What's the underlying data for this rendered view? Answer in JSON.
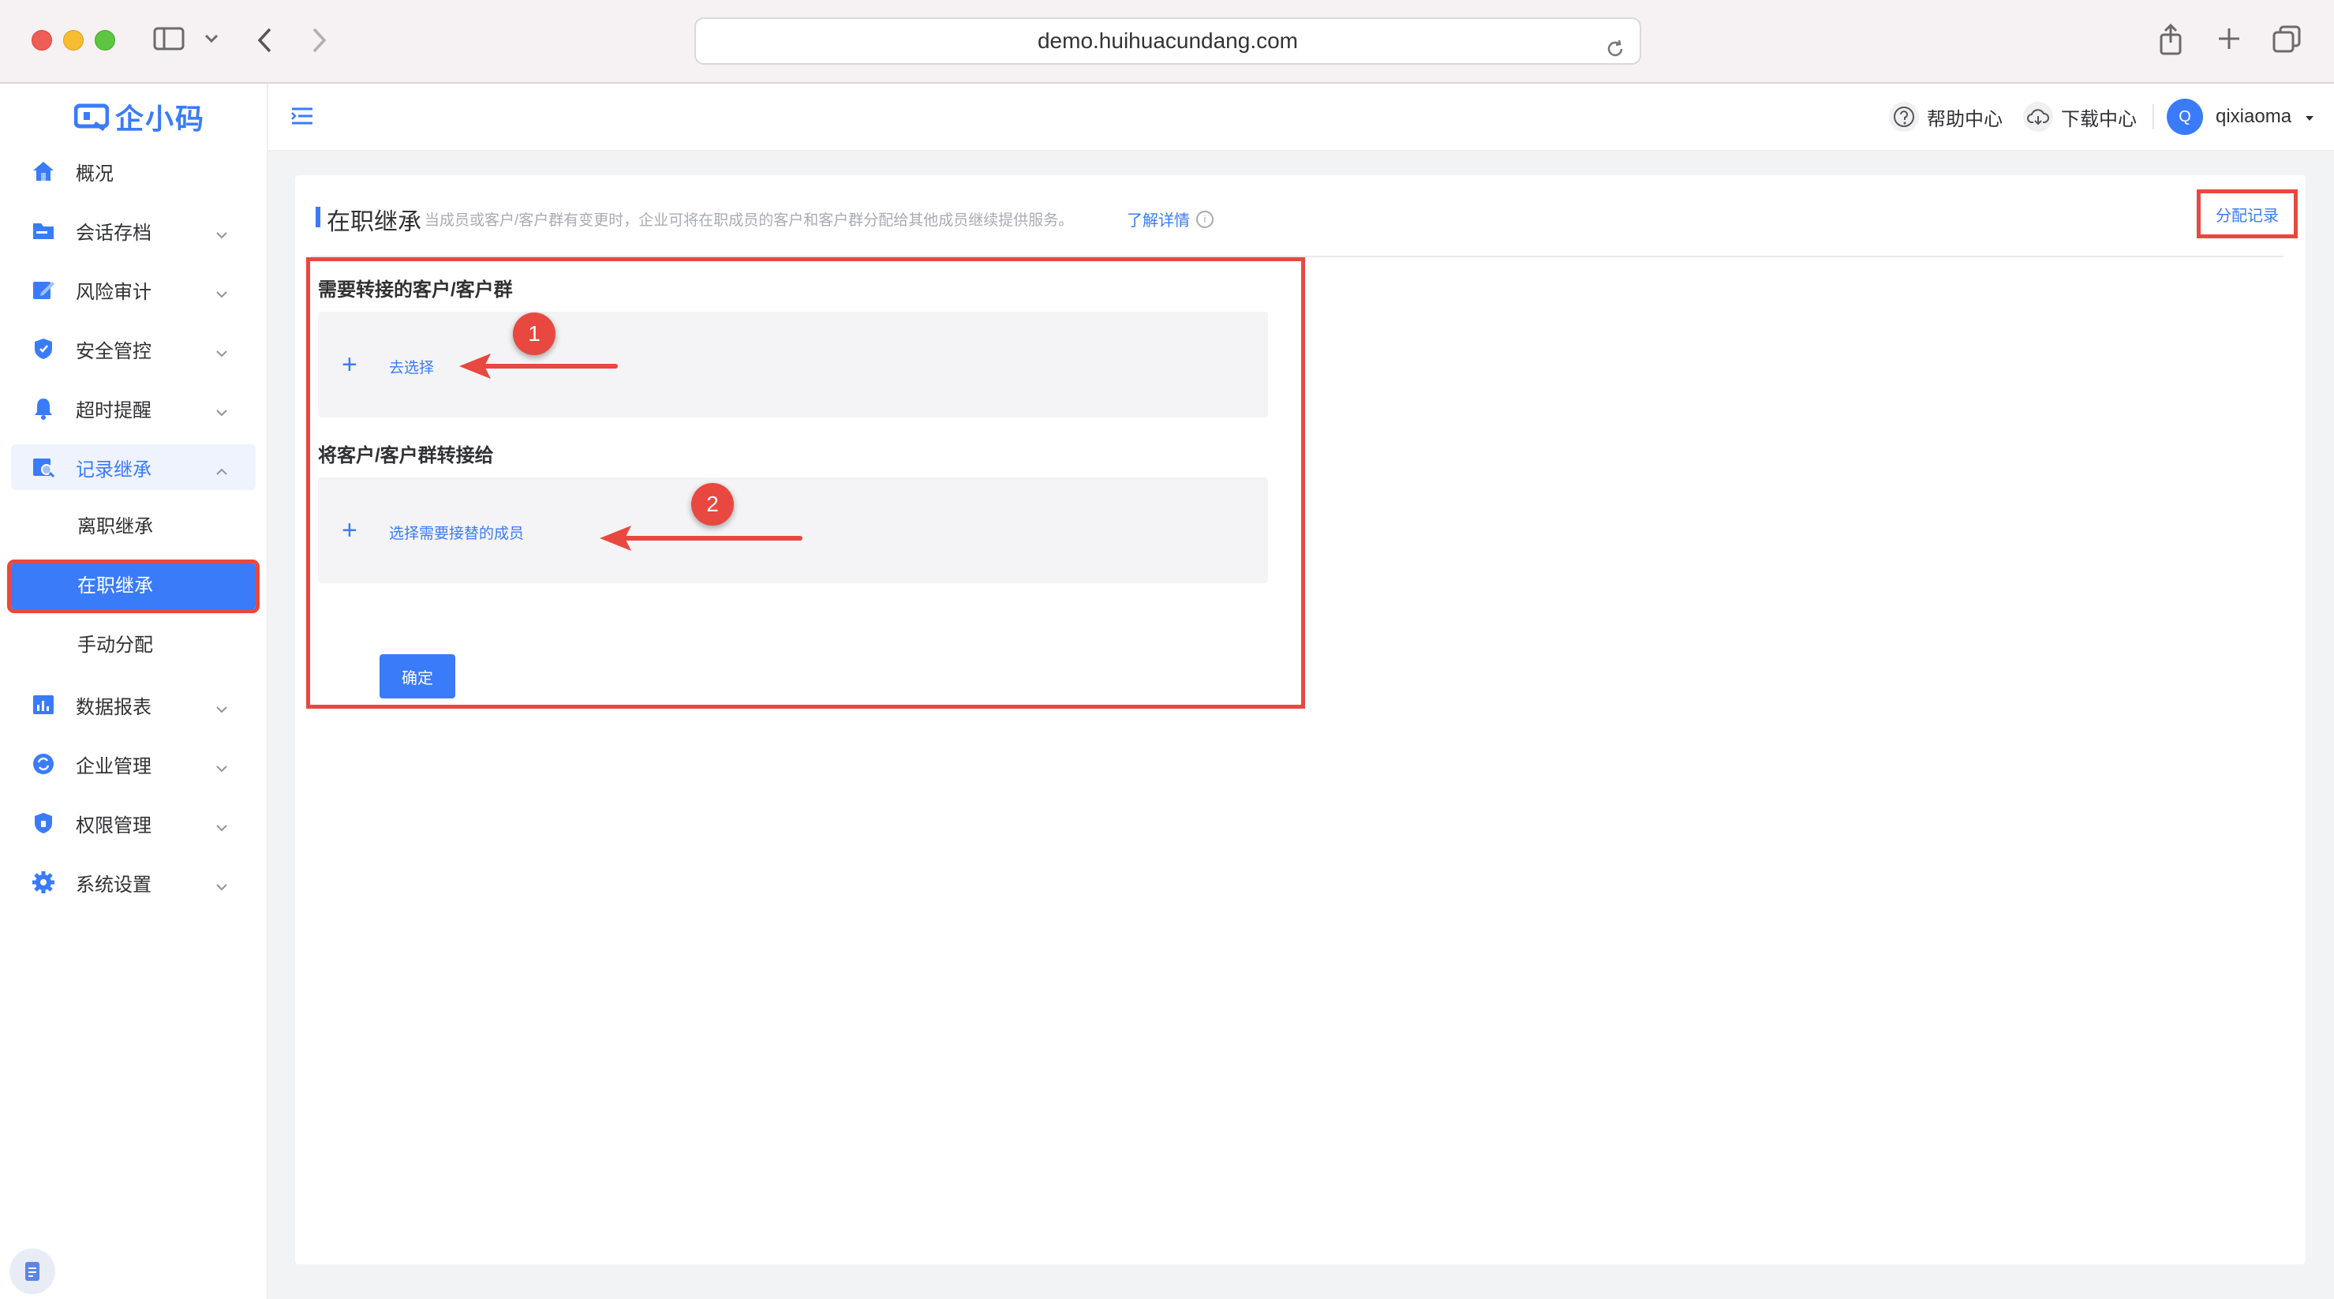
{
  "browser": {
    "url": "demo.huihuacundang.com"
  },
  "sidebar": {
    "logo_text": "企小码",
    "items": [
      {
        "label": "概况",
        "icon": "home-icon"
      },
      {
        "label": "会话存档",
        "icon": "folder-icon"
      },
      {
        "label": "风险审计",
        "icon": "edit-icon"
      },
      {
        "label": "安全管控",
        "icon": "shield-icon"
      },
      {
        "label": "超时提醒",
        "icon": "bell-icon"
      },
      {
        "label": "记录继承",
        "icon": "record-icon"
      },
      {
        "label": "数据报表",
        "icon": "chart-icon"
      },
      {
        "label": "企业管理",
        "icon": "sync-icon"
      },
      {
        "label": "权限管理",
        "icon": "lock-shield-icon"
      },
      {
        "label": "系统设置",
        "icon": "gear-icon"
      }
    ],
    "sub_items": [
      "离职继承",
      "在职继承",
      "手动分配"
    ],
    "active_sub": "在职继承"
  },
  "header": {
    "help_label": "帮助中心",
    "download_label": "下载中心",
    "avatar_letter": "Q",
    "username": "qixiaoma"
  },
  "page": {
    "title": "在职继承",
    "description": "当成员或客户/客户群有变更时，企业可将在职成员的客户和客户群分配给其他成员继续提供服务。",
    "detail_link": "了解详情",
    "record_link": "分配记录",
    "section1_label": "需要转接的客户/客户群",
    "section1_action": "去选择",
    "section2_label": "将客户/客户群转接给",
    "section2_action": "选择需要接替的成员",
    "confirm_label": "确定"
  },
  "annotations": {
    "badge1": "1",
    "badge2": "2",
    "color": "#e8483f"
  },
  "colors": {
    "accent": "#3a7bfa",
    "highlight": "#e8483f"
  }
}
